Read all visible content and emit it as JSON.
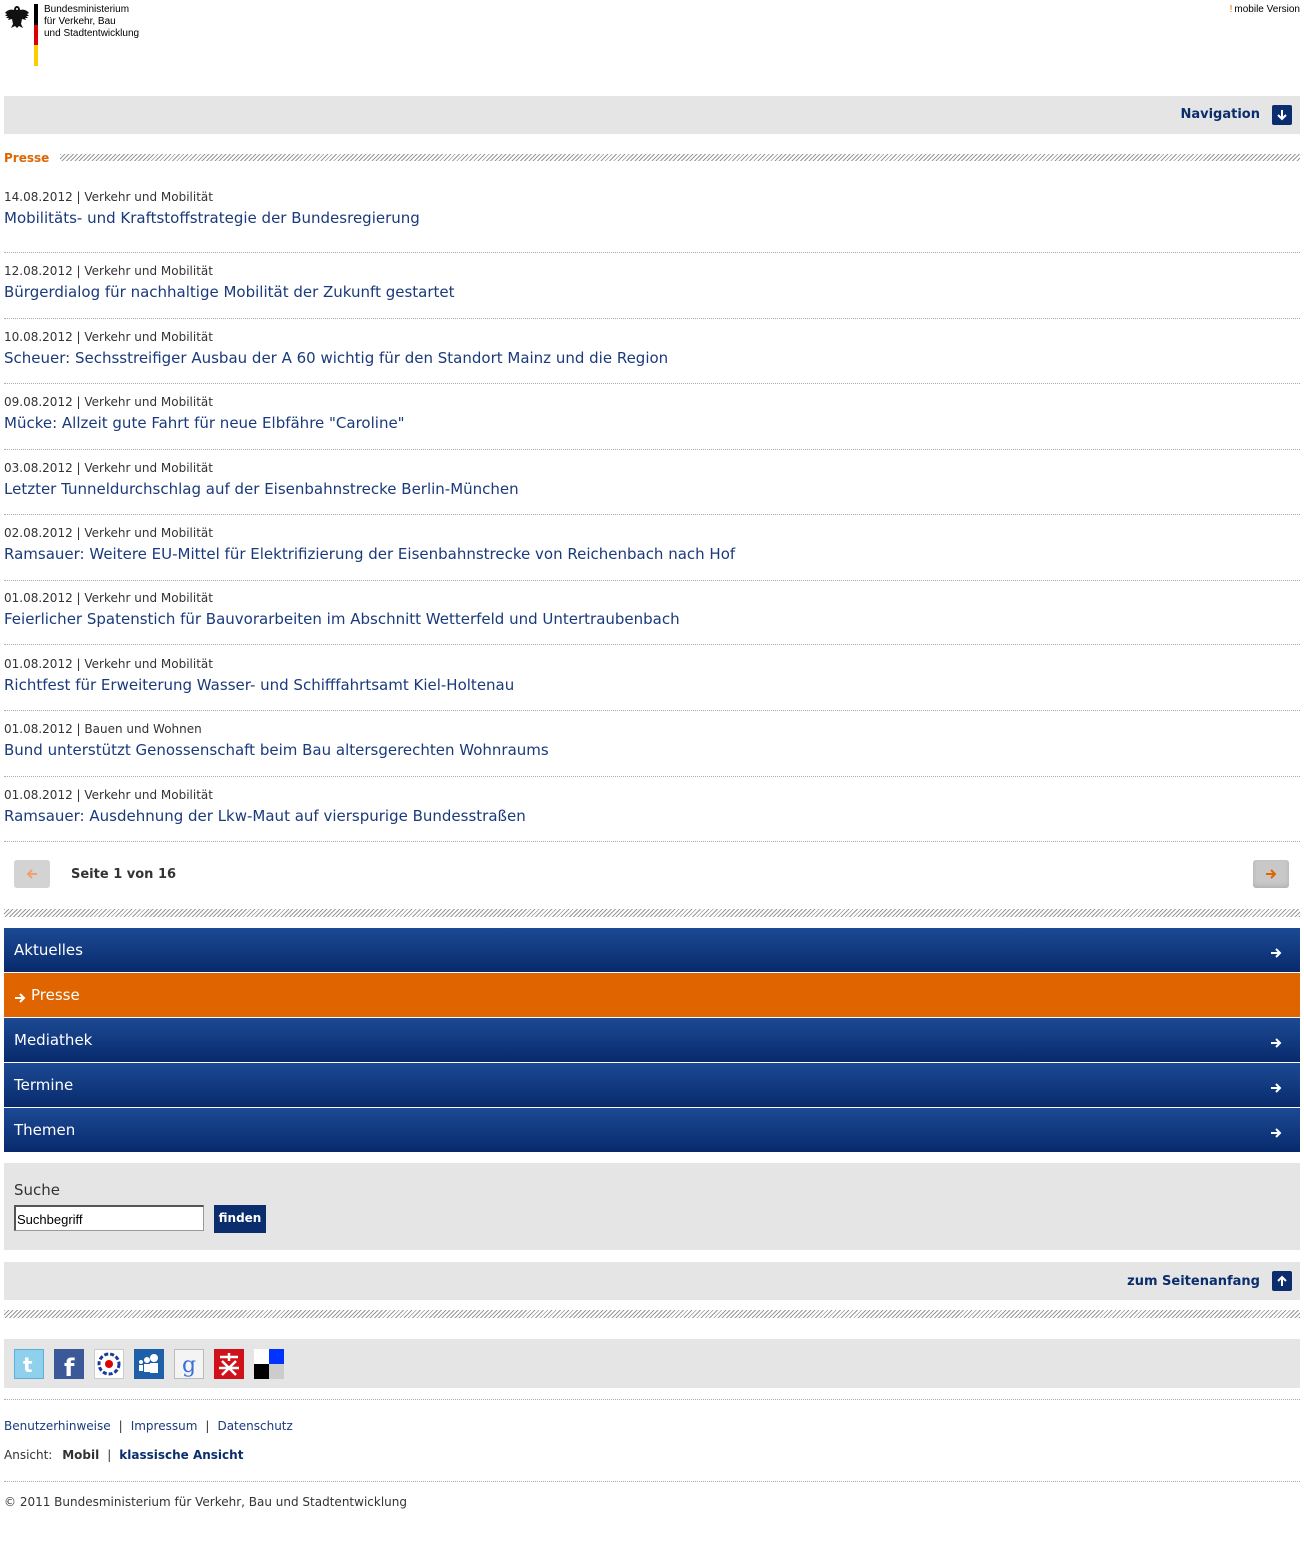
{
  "header": {
    "ministry_name": "Bundesministerium\nfür Verkehr, Bau\nund Stadtentwicklung",
    "mobile_version_label": "mobile Version"
  },
  "navbar": {
    "label": "Navigation"
  },
  "section": {
    "title": "Presse"
  },
  "news": [
    {
      "date": "14.08.2012",
      "category": "Verkehr und Mobilität",
      "headline": "Mobilitäts- und Kraftstoffstrategie der Bundesregierung"
    },
    {
      "date": "12.08.2012",
      "category": "Verkehr und Mobilität",
      "headline": "Bürgerdialog für nachhaltige Mobilität der Zukunft gestartet"
    },
    {
      "date": "10.08.2012",
      "category": "Verkehr und Mobilität",
      "headline": "Scheuer: Sechsstreifiger Ausbau der A 60 wichtig für den Standort Mainz und die Region"
    },
    {
      "date": "09.08.2012",
      "category": "Verkehr und Mobilität",
      "headline": "Mücke: Allzeit gute Fahrt für neue Elbfähre \"Caroline\""
    },
    {
      "date": "03.08.2012",
      "category": "Verkehr und Mobilität",
      "headline": "Letzter Tunneldurchschlag auf der Eisenbahnstrecke Berlin-München"
    },
    {
      "date": "02.08.2012",
      "category": "Verkehr und Mobilität",
      "headline": "Ramsauer: Weitere EU-Mittel für Elektrifizierung der Eisenbahnstrecke von Reichenbach nach Hof"
    },
    {
      "date": "01.08.2012",
      "category": "Verkehr und Mobilität",
      "headline": "Feierlicher Spatenstich für Bauvorarbeiten im Abschnitt Wetterfeld und Untertraubenbach"
    },
    {
      "date": "01.08.2012",
      "category": "Verkehr und Mobilität",
      "headline": "Richtfest für Erweiterung Wasser- und Schifffahrtsamt Kiel-Holtenau"
    },
    {
      "date": "01.08.2012",
      "category": "Bauen und Wohnen",
      "headline": "Bund unterstützt Genossenschaft beim Bau altersgerechten Wohnraums"
    },
    {
      "date": "01.08.2012",
      "category": "Verkehr und Mobilität",
      "headline": "Ramsauer: Ausdehnung der Lkw-Maut auf vierspurige Bundesstraßen"
    }
  ],
  "pagination": {
    "label": "Seite 1 von 16"
  },
  "menu": [
    {
      "label": "Aktuelles",
      "active": false
    },
    {
      "label": "Presse",
      "active": true
    },
    {
      "label": "Mediathek",
      "active": false
    },
    {
      "label": "Termine",
      "active": false
    },
    {
      "label": "Themen",
      "active": false
    }
  ],
  "search": {
    "title": "Suche",
    "value": "Suchbegriff",
    "button": "finden"
  },
  "top_link": {
    "label": "zum Seitenanfang"
  },
  "social_icons": [
    "twitter-icon",
    "facebook-icon",
    "webnews-icon",
    "myspace-icon",
    "google-icon",
    "misterwong-icon",
    "delicious-icon"
  ],
  "footer": {
    "links": [
      "Benutzerhinweise",
      "Impressum",
      "Datenschutz"
    ],
    "view_label": "Ansicht:",
    "view_mobile": "Mobil",
    "view_classic": "klassische Ansicht",
    "copyright": "© 2011 Bundesministerium für Verkehr, Bau und Stadtentwicklung"
  },
  "colors": {
    "brand_blue": "#0b2d6e",
    "accent_orange": "#e06500",
    "panel_gray": "#e5e5e5"
  }
}
